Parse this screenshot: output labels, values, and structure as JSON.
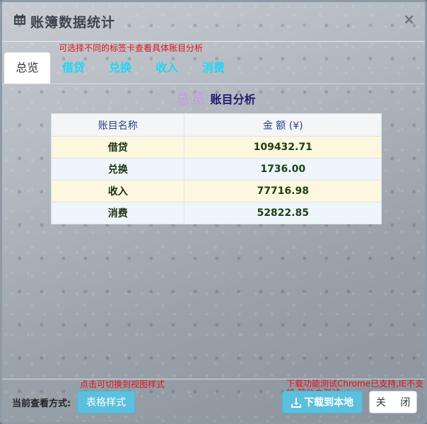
{
  "dialog": {
    "title": "账簿数据统计",
    "title_icon": "calendar-icon",
    "close_symbol": "×"
  },
  "hints": {
    "top": "可选择不同的标签卡查看具体账目分析",
    "style_switch": "点击可切换到视图样式",
    "download": "下载功能测试Chrome已支持,IE不支持,其他未测试"
  },
  "tabs": [
    {
      "label": "总览",
      "active": true
    },
    {
      "label": "借贷",
      "active": false
    },
    {
      "label": "兑换",
      "active": false
    },
    {
      "label": "收入",
      "active": false
    },
    {
      "label": "消费",
      "active": false
    }
  ],
  "heading": {
    "main": "总览",
    "sub": "账目分析"
  },
  "table": {
    "headers": [
      "账目名称",
      "金 额 (¥)"
    ],
    "rows": [
      {
        "name": "借贷",
        "amount": "109432.71"
      },
      {
        "name": "兑换",
        "amount": "1736.00"
      },
      {
        "name": "收入",
        "amount": "77716.98"
      },
      {
        "name": "消费",
        "amount": "52822.85"
      }
    ]
  },
  "footer": {
    "mode_label": "当前查看方式:",
    "style_button": "表格样式",
    "download_button": "下载到本地",
    "download_icon": "download-icon",
    "close_button": "关 闭"
  },
  "colors": {
    "accent": "#5bc0de",
    "tab_text": "#22d6f4",
    "hint": "#e0141a",
    "row_odd": "#fcf7df",
    "row_even": "#eef6fc"
  }
}
